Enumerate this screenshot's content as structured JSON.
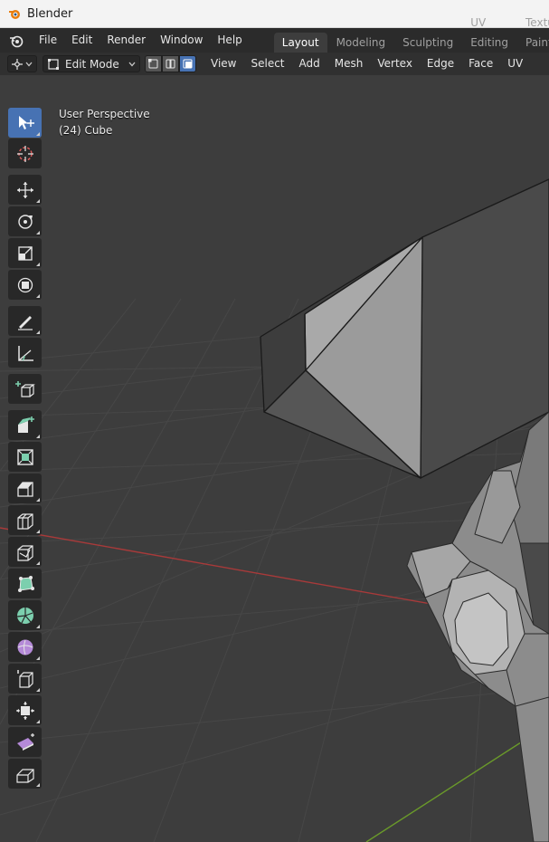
{
  "window": {
    "title": "Blender"
  },
  "topbar": {
    "menus": [
      "File",
      "Edit",
      "Render",
      "Window",
      "Help"
    ],
    "workspaces": [
      {
        "label": "Layout",
        "active": true
      },
      {
        "label": "Modeling",
        "active": false
      },
      {
        "label": "Sculpting",
        "active": false
      },
      {
        "label": "UV Editing",
        "active": false
      },
      {
        "label": "Texture Paint",
        "active": false
      }
    ]
  },
  "header": {
    "editor_type_icon": "3d-viewport-icon",
    "mode": "Edit Mode",
    "select_modes": [
      {
        "name": "vertex-select-icon",
        "active": false
      },
      {
        "name": "edge-select-icon",
        "active": false
      },
      {
        "name": "face-select-icon",
        "active": true
      }
    ],
    "menus": [
      "View",
      "Select",
      "Add",
      "Mesh",
      "Vertex",
      "Edge",
      "Face",
      "UV"
    ]
  },
  "viewport": {
    "perspective": "User Perspective",
    "object": "(24) Cube"
  },
  "toolbar": {
    "tools": [
      {
        "name": "select-box-icon",
        "active": true
      },
      {
        "name": "cursor-icon",
        "active": false
      },
      {
        "name": "move-icon",
        "active": false
      },
      {
        "name": "rotate-icon",
        "active": false
      },
      {
        "name": "scale-icon",
        "active": false
      },
      {
        "name": "transform-icon",
        "active": false
      },
      {
        "name": "annotate-icon",
        "active": false
      },
      {
        "name": "measure-icon",
        "active": false
      },
      {
        "name": "add-cube-icon",
        "active": false
      },
      {
        "name": "extrude-region-icon",
        "active": false
      },
      {
        "name": "inset-faces-icon",
        "active": false
      },
      {
        "name": "bevel-icon",
        "active": false
      },
      {
        "name": "loop-cut-icon",
        "active": false
      },
      {
        "name": "knife-icon",
        "active": false
      },
      {
        "name": "poly-build-icon",
        "active": false
      },
      {
        "name": "spin-icon",
        "active": false
      },
      {
        "name": "smooth-icon",
        "active": false
      },
      {
        "name": "edge-slide-icon",
        "active": false
      },
      {
        "name": "shrink-fatten-icon",
        "active": false
      },
      {
        "name": "shear-icon",
        "active": false
      },
      {
        "name": "rip-region-icon",
        "active": false
      }
    ]
  },
  "colors": {
    "accent": "#4772b3",
    "x_axis": "#a83a3a",
    "y_axis": "#6a9a2a",
    "mesh": "#9a9a9a"
  }
}
